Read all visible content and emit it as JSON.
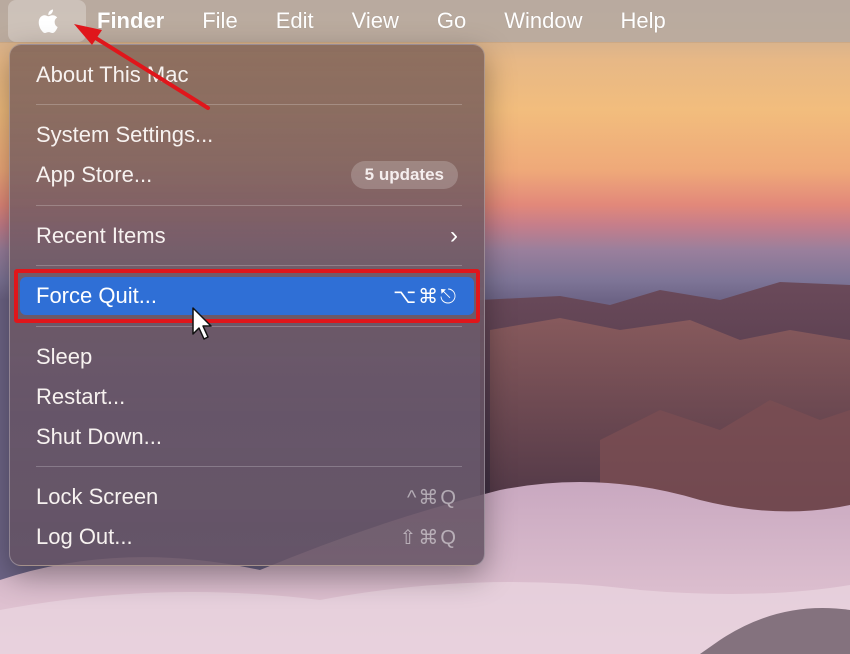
{
  "menubar": {
    "apple_icon": "apple-logo-icon",
    "app_name": "Finder",
    "items": [
      "File",
      "Edit",
      "View",
      "Go",
      "Window",
      "Help"
    ]
  },
  "apple_menu": {
    "about": "About This Mac",
    "system_settings": "System Settings...",
    "app_store": "App Store...",
    "app_store_badge": "5 updates",
    "recent_items": "Recent Items",
    "recent_items_arrow": "›",
    "force_quit": "Force Quit...",
    "force_quit_shortcut": "⌥⌘⎋",
    "sleep": "Sleep",
    "restart": "Restart...",
    "shut_down": "Shut Down...",
    "lock_screen": "Lock Screen",
    "lock_screen_shortcut": "^⌘Q",
    "log_out": "Log Out...",
    "log_out_shortcut": "⇧⌘Q"
  },
  "colors": {
    "highlight_row": "#2f6fd6",
    "annotation_red": "#e0161b"
  }
}
